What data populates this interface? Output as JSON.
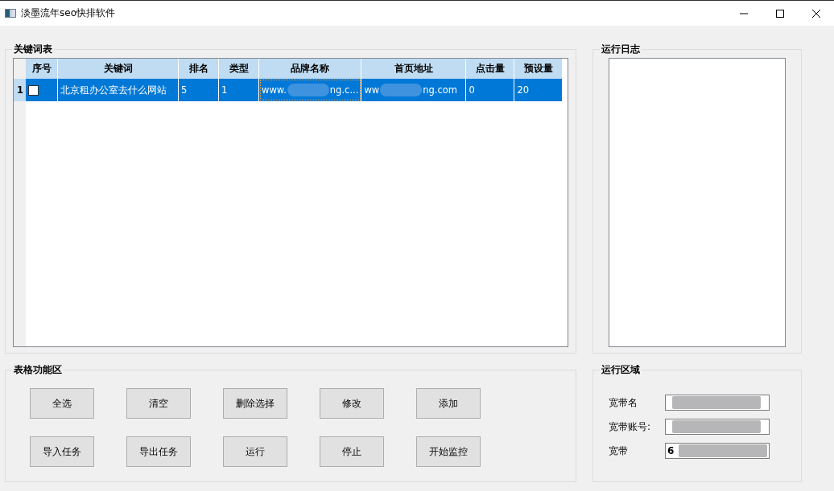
{
  "window": {
    "title": "淡墨流年seo快排软件"
  },
  "keyword_table": {
    "title": "关键词表",
    "columns": [
      "序号",
      "关键词",
      "排名",
      "类型",
      "品牌名称",
      "首页地址",
      "点击量",
      "预设量"
    ],
    "rows": [
      {
        "row_number": "1",
        "selected": true,
        "cells": [
          {
            "kind": "checkbox",
            "checked": false
          },
          {
            "text": "北京租办公室去什么网站"
          },
          {
            "text": "5"
          },
          {
            "text": "1"
          },
          {
            "kind": "redacted",
            "before": "www.",
            "after": "ng.c...",
            "focused": true
          },
          {
            "kind": "redacted",
            "before": "ww",
            "after": "ng.com",
            "focused": false
          },
          {
            "text": "0"
          },
          {
            "text": "20"
          }
        ]
      }
    ]
  },
  "log_panel": {
    "title": "运行日志"
  },
  "functions": {
    "title": "表格功能区",
    "buttons": [
      [
        "全选",
        "清空",
        "删除选择",
        "修改",
        "添加"
      ],
      [
        "导入任务",
        "导出任务",
        "运行",
        "停止",
        "开始监控"
      ]
    ]
  },
  "run_area": {
    "title": "运行区域",
    "fields": [
      {
        "label": "宽带名",
        "value_redacted": true
      },
      {
        "label": "宽带账号:",
        "value_redacted": true
      },
      {
        "label": "宽带",
        "value": "6",
        "value_redacted": true
      }
    ]
  }
}
